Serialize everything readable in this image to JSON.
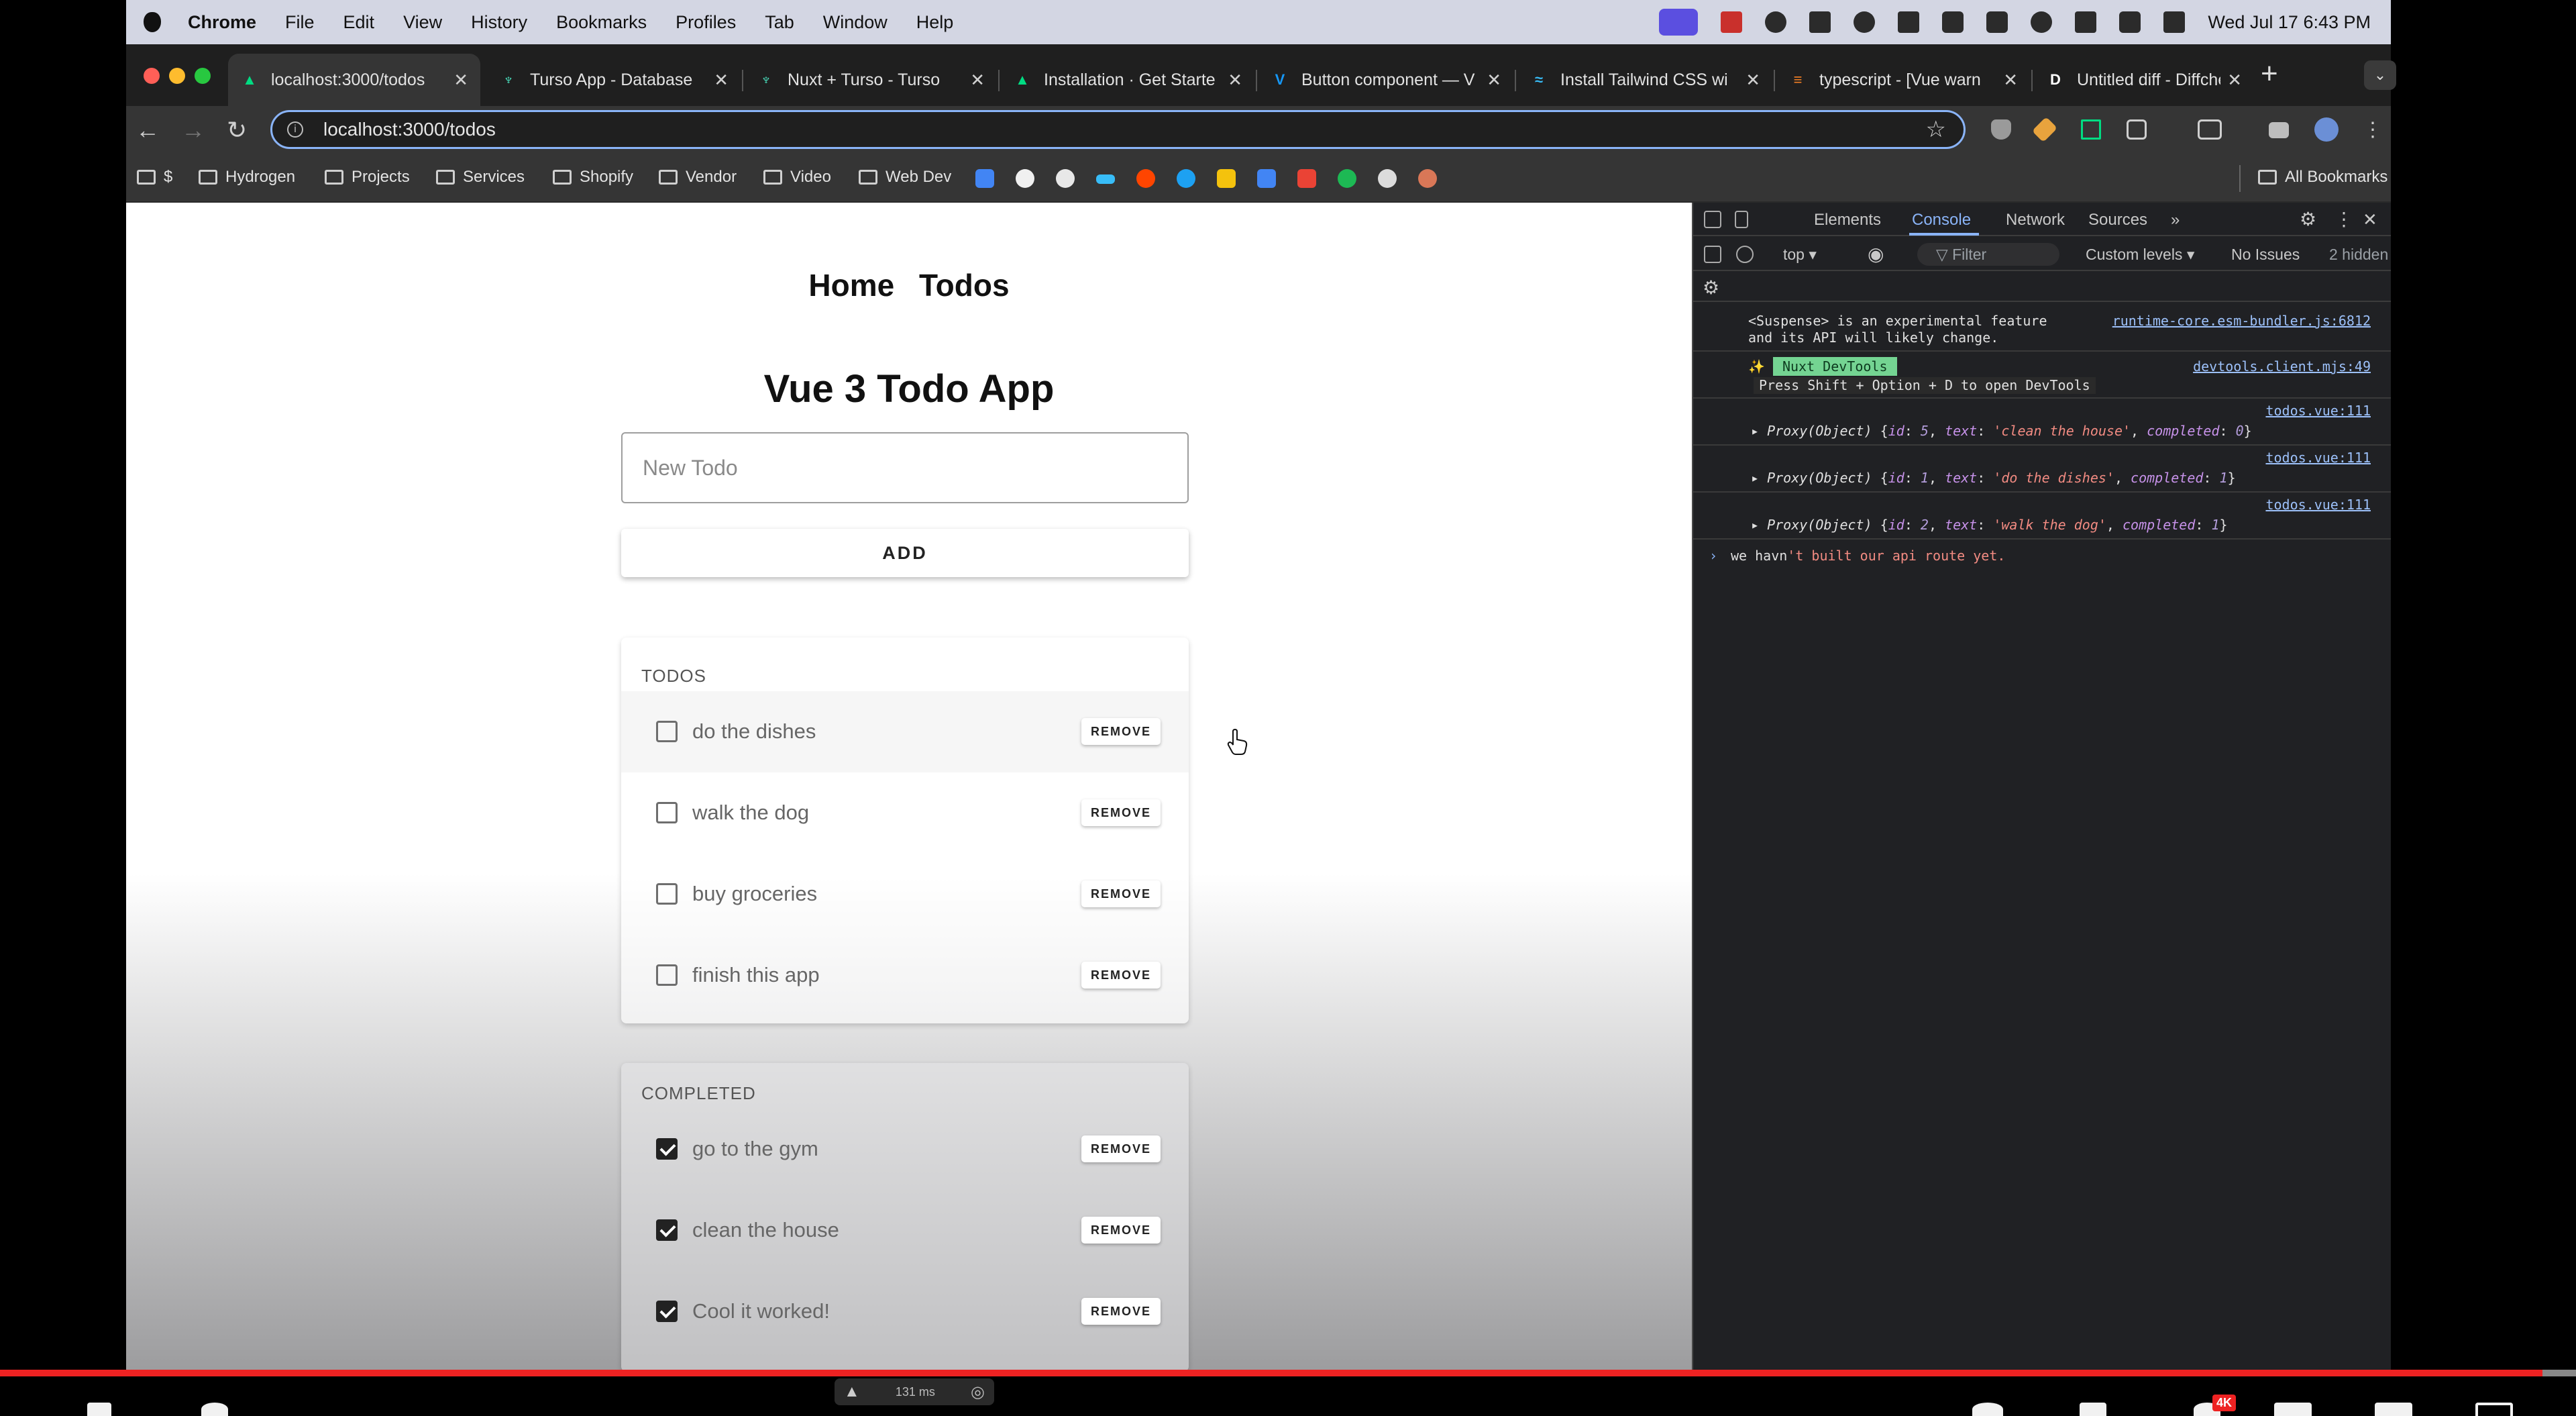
{
  "menubar": {
    "app": "Chrome",
    "items": [
      "File",
      "Edit",
      "View",
      "History",
      "Bookmarks",
      "Profiles",
      "Tab",
      "Window",
      "Help"
    ],
    "clock": "Wed Jul 17  6:43 PM"
  },
  "tabs": [
    {
      "label": "localhost:3000/todos",
      "favicon": "nuxt-icon",
      "color": "#00dc82"
    },
    {
      "label": "Turso App - Database",
      "favicon": "turso-icon",
      "color": "#4ff8d2"
    },
    {
      "label": "Nuxt + Turso - Turso",
      "favicon": "turso-icon",
      "color": "#4ff8d2"
    },
    {
      "label": "Installation · Get Starte",
      "favicon": "nuxt-icon",
      "color": "#00dc82"
    },
    {
      "label": "Button component — V",
      "favicon": "vuetify-icon",
      "color": "#1697f6"
    },
    {
      "label": "Install Tailwind CSS wi",
      "favicon": "tailwind-icon",
      "color": "#38bdf8"
    },
    {
      "label": "typescript - [Vue warn",
      "favicon": "stackoverflow-icon",
      "color": "#f48024"
    },
    {
      "label": "Untitled diff - Diffchec",
      "favicon": "diffchecker-icon",
      "color": "#ffffff"
    }
  ],
  "toolbar": {
    "url": "localhost:3000/todos"
  },
  "bookmarks": {
    "folders": [
      "$",
      "Hydrogen",
      "Projects",
      "Services",
      "Shopify",
      "Vendor",
      "Video",
      "Web Dev"
    ],
    "all": "All Bookmarks"
  },
  "page": {
    "nav": {
      "home": "Home",
      "todos": "Todos"
    },
    "title": "Vue 3 Todo App",
    "input_placeholder": "New Todo",
    "add_label": "ADD",
    "todos_heading": "TODOS",
    "todos": [
      {
        "text": "do the dishes",
        "completed": false
      },
      {
        "text": "walk the dog",
        "completed": false
      },
      {
        "text": "buy groceries",
        "completed": false
      },
      {
        "text": "finish this app",
        "completed": false
      }
    ],
    "completed_heading": "COMPLETED",
    "completed": [
      {
        "text": "go to the gym",
        "completed": true
      },
      {
        "text": "clean the house",
        "completed": true
      },
      {
        "text": "Cool it worked!",
        "completed": true
      }
    ],
    "remove_label": "REMOVE"
  },
  "devtools": {
    "tabs": [
      "Elements",
      "Console",
      "Network",
      "Sources"
    ],
    "active_tab": "Console",
    "context": "top",
    "filter_placeholder": "Filter",
    "levels": "Custom levels",
    "issues": "No Issues",
    "hidden": "2 hidden",
    "messages": {
      "suspense_line1": "<Suspense> is an experimental feature",
      "suspense_line2": "and its API will likely change.",
      "suspense_src": "runtime-core.esm-bundler.js:6812",
      "nuxt_badge": "Nuxt DevTools",
      "nuxt_line": "Press Shift + Option + D to open DevTools",
      "nuxt_src": "devtools.client.mjs:49",
      "log_src": "todos.vue:111",
      "proxies": [
        {
          "id": "5",
          "text": "'clean the house'",
          "completed": "0"
        },
        {
          "id": "1",
          "text": "'do the dishes'",
          "completed": "1"
        },
        {
          "id": "2",
          "text": "'walk the dog'",
          "completed": "1"
        }
      ],
      "last_a": "we havn",
      "last_b": "'t built our api route yet."
    }
  },
  "nuxtbar": {
    "timing": "131 ms"
  },
  "video": {
    "quality_badge": "4K",
    "progress": 0.987
  }
}
